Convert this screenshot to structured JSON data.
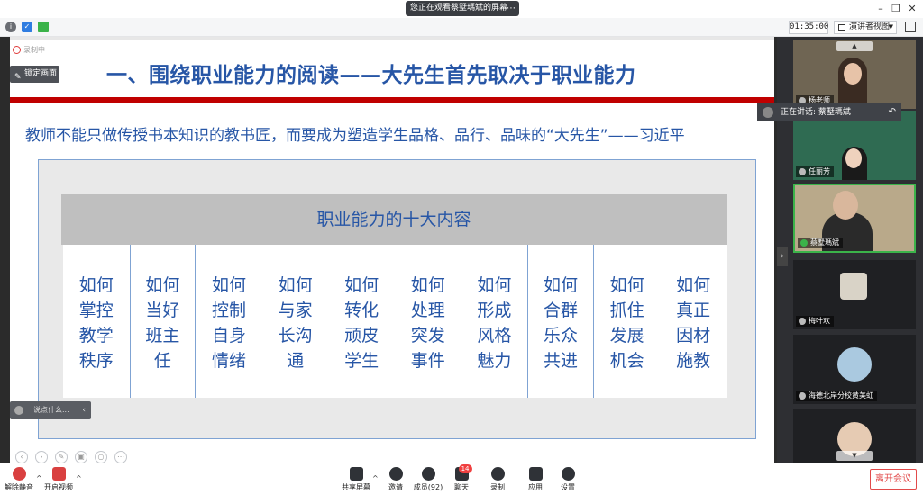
{
  "titlebar": {
    "share_notice": "您正在观看蔡墅瑪斌的屏幕",
    "share_options": "⋯"
  },
  "toolbar": {
    "timer": "01:35:00",
    "view_label": "演讲者视图"
  },
  "slide": {
    "recording_mark": "录制中",
    "lock_label": "锁定画面",
    "title": "一、围绕职业能力的阅读——大先生首先取决于职业能力",
    "quote": "教师不能只做传授书本知识的教书匠，而要成为塑造学生品格、品行、品味的“大先生”——习近平",
    "box_header": "职业能力的十大内容",
    "columns": [
      [
        "如何",
        "掌控",
        "教学",
        "秩序"
      ],
      [
        "如何",
        "当好",
        "班主",
        "任"
      ],
      [
        "如何",
        "控制",
        "自身",
        "情绪"
      ],
      [
        "如何",
        "与家",
        "长沟",
        "通"
      ],
      [
        "如何",
        "转化",
        "顽皮",
        "学生"
      ],
      [
        "如何",
        "处理",
        "突发",
        "事件"
      ],
      [
        "如何",
        "形成",
        "风格",
        "魅力"
      ],
      [
        "如何",
        "合群",
        "乐众",
        "共进"
      ],
      [
        "如何",
        "抓住",
        "发展",
        "机会"
      ],
      [
        "如何",
        "真正",
        "因材",
        "施教"
      ]
    ],
    "chat_placeholder": "说点什么..."
  },
  "speaking": {
    "label": "正在讲话: 蔡墅瑪斌"
  },
  "participants": [
    {
      "name": "杨老师"
    },
    {
      "name": "任丽芳"
    },
    {
      "name": "蔡墅瑪斌"
    },
    {
      "name": "梅叶欢"
    },
    {
      "name": "海德北岸分校黄美虹"
    },
    {
      "name": ""
    }
  ],
  "bottombar": {
    "mute": "解除静音",
    "video": "开启视频",
    "share": "共享屏幕",
    "invite": "邀请",
    "members": "成员(92)",
    "chat": "聊天",
    "chat_badge": "14",
    "record": "录制",
    "apps": "应用",
    "settings": "设置",
    "leave": "离开会议"
  },
  "colors": {
    "accent_blue": "#2756a6",
    "title_red_bar": "#c00000",
    "leave_red": "#e24a4a",
    "active_tile_green": "#3bb34a"
  }
}
